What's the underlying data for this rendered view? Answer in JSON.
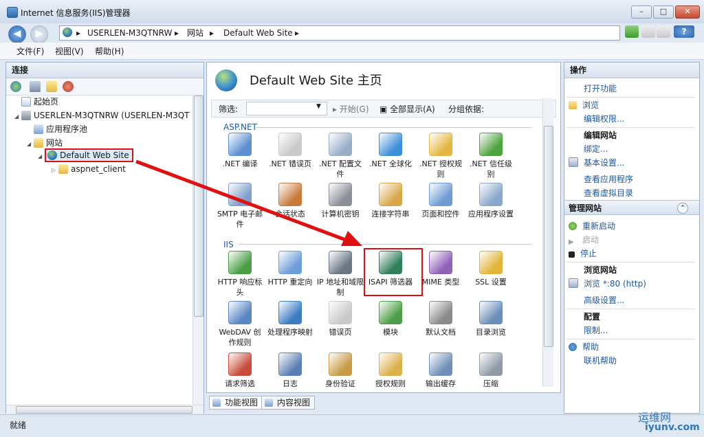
{
  "window": {
    "title": "Internet 信息服务(IIS)管理器",
    "min": "–",
    "max": "□",
    "close": "✕"
  },
  "address": {
    "server": "USERLEN-M3QTNRW",
    "sites": "网站",
    "site": "Default Web Site",
    "sep": "▸"
  },
  "menu": {
    "file": "文件(F)",
    "view": "视图(V)",
    "help": "帮助(H)"
  },
  "left": {
    "header": "连接",
    "tree": [
      {
        "label": "起始页",
        "icon": "page"
      },
      {
        "label": "USERLEN-M3QTNRW (USERLEN-M3QT",
        "icon": "server"
      },
      {
        "label": "应用程序池",
        "icon": "pool"
      },
      {
        "label": "网站",
        "icon": "folder"
      },
      {
        "label": "Default Web Site",
        "icon": "globe"
      },
      {
        "label": "aspnet_client",
        "icon": "folder"
      }
    ]
  },
  "center": {
    "title": "Default Web Site 主页",
    "filter_label": "筛选:",
    "start": "开始(G)",
    "show_all": "全部显示(A)",
    "group_by": "分组依据:",
    "sections": {
      "aspnet": "ASP.NET",
      "iis": "IIS"
    },
    "icons": [
      {
        "label": ".NET 编译",
        "color": "#5a8fd0"
      },
      {
        "label": ".NET 错误页",
        "color": "#c9c9c9"
      },
      {
        "label": ".NET 配置文件",
        "color": "#9aaec8"
      },
      {
        "label": ".NET 全球化",
        "color": "#3d8fd8"
      },
      {
        "label": ".NET 授权规则",
        "color": "#e3b840"
      },
      {
        "label": ".NET 信任级别",
        "color": "#4ea33e"
      },
      {
        "label": "SMTP 电子邮件",
        "color": "#7d9fca"
      },
      {
        "label": "会话状态",
        "color": "#c77a3b"
      },
      {
        "label": "计算机密钥",
        "color": "#8a8f98"
      },
      {
        "label": "连接字符串",
        "color": "#d7a84a"
      },
      {
        "label": "页面和控件",
        "color": "#6f9bd3"
      },
      {
        "label": "应用程序设置",
        "color": "#8aa6c9"
      },
      {
        "label": "HTTP 响应标头",
        "color": "#4b9e45"
      },
      {
        "label": "HTTP 重定向",
        "color": "#6d9ed6"
      },
      {
        "label": "IP 地址和域限制",
        "color": "#6b7685"
      },
      {
        "label": "ISAPI 筛选器",
        "color": "#2f7f5a"
      },
      {
        "label": "MIME 类型",
        "color": "#8f62b8"
      },
      {
        "label": "SSL 设置",
        "color": "#e1b43a"
      },
      {
        "label": "WebDAV 创作规则",
        "color": "#5a86c4"
      },
      {
        "label": "处理程序映射",
        "color": "#3c7cc2"
      },
      {
        "label": "错误页",
        "color": "#c9c9c9"
      },
      {
        "label": "模块",
        "color": "#4e9e47"
      },
      {
        "label": "默认文档",
        "color": "#8a8a8a"
      },
      {
        "label": "目录浏览",
        "color": "#6a8db8"
      },
      {
        "label": "请求筛选",
        "color": "#c94a3a"
      },
      {
        "label": "日志",
        "color": "#5b7fb2"
      },
      {
        "label": "身份验证",
        "color": "#c79a45"
      },
      {
        "label": "授权规则",
        "color": "#dcb04a"
      },
      {
        "label": "输出缓存",
        "color": "#6f8fb8"
      },
      {
        "label": "压缩",
        "color": "#8f9aa6"
      }
    ],
    "tabs": {
      "features": "功能视图",
      "content": "内容视图"
    }
  },
  "right": {
    "header": "操作",
    "items": {
      "open": "打开功能",
      "browse": "浏览",
      "edit_perm": "编辑权限...",
      "edit_site": "编辑网站",
      "bindings": "绑定...",
      "basic": "基本设置...",
      "view_apps": "查看应用程序",
      "view_vdirs": "查看虚拟目录",
      "manage": "管理网站",
      "restart": "重新启动",
      "start": "启动",
      "stop": "停止",
      "browse_site": "浏览网站",
      "browse_80": "浏览 *:80 (http)",
      "advanced": "高级设置...",
      "config": "配置",
      "limits": "限制...",
      "help": "帮助",
      "online_help": "联机帮助"
    }
  },
  "status": "就绪",
  "watermark": {
    "name": "运维网",
    "url": "iyunv.com"
  }
}
